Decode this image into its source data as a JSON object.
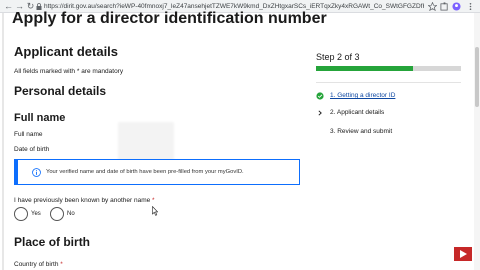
{
  "browser": {
    "url": "https://dirit.gov.au/search?ieWP-40fmnoxj7_leZ47ansehjetTZWE7kW9kmd_DxZHtgxarSCs_iERTqxZky4xRGAWt_Co_SWtGFGZDfKlyjbWRxFbWh",
    "icons": [
      "back-icon",
      "forward-icon",
      "reload-icon",
      "lock-icon",
      "star-icon",
      "extension-icon",
      "profile-icon",
      "menu-icon"
    ]
  },
  "page": {
    "title": "Apply for a director identification number",
    "applicant_heading": "Applicant details",
    "mandatory_note": "All fields marked with * are mandatory",
    "personal_heading": "Personal details",
    "fullname_heading": "Full name",
    "fullname_label": "Full name",
    "dob_label": "Date of birth",
    "info_message": "Your verified name and date of birth have been pre-filled from your myGovID.",
    "previous_name_question": "I have previously been known by another name",
    "required_marker": "*",
    "radio_yes": "Yes",
    "radio_no": "No",
    "birth_heading": "Place of birth",
    "country_label": "Country of birth",
    "country_marker": "*"
  },
  "sidebar": {
    "step_title": "Step 2 of 3",
    "progress_fraction": 0.67,
    "progress_color": "#25a43a",
    "steps": [
      {
        "label": "1.  Getting a director ID",
        "state": "complete",
        "icon": "check-circle-icon"
      },
      {
        "label": "2.  Applicant details",
        "state": "current",
        "icon": "chevron-right-icon"
      },
      {
        "label": "3.  Review and submit",
        "state": "upcoming",
        "icon": ""
      }
    ]
  },
  "colors": {
    "info_border": "#0d6efd",
    "link": "#0d47a1",
    "required": "#c62828"
  }
}
